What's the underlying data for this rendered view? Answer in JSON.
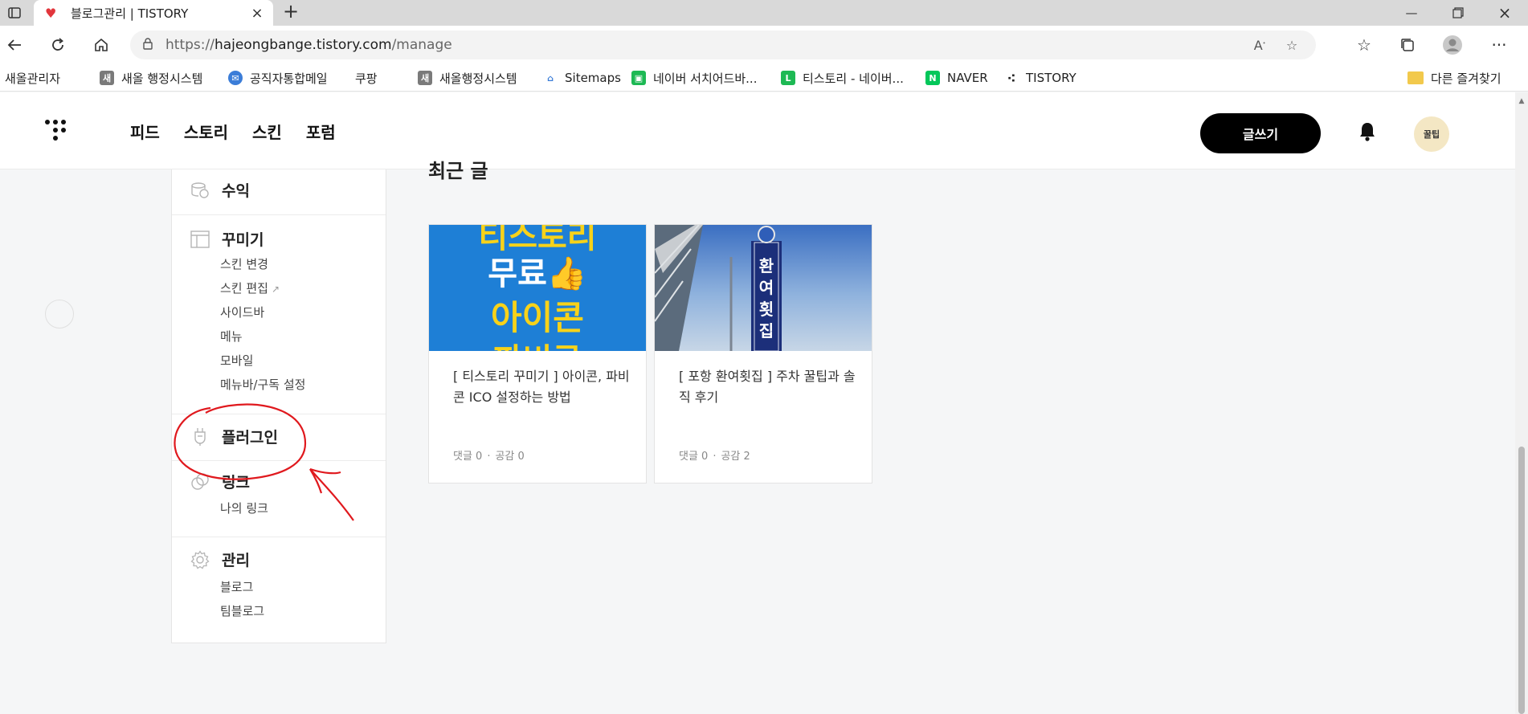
{
  "browser": {
    "tab_title": "블로그관리 | TISTORY",
    "new_tab": "+",
    "url_scheme": "https://",
    "url_host": "hajeongbange.tistory.com",
    "url_path": "/manage"
  },
  "bookmarks": [
    {
      "label": "새올관리자",
      "icon": "page-icon"
    },
    {
      "label": "새올 행정시스템",
      "icon": "saeol-icon"
    },
    {
      "label": "공직자통합메일",
      "icon": "mail-icon"
    },
    {
      "label": "쿠팡",
      "icon": "page-icon"
    },
    {
      "label": "새올행정시스템",
      "icon": "saeol-icon"
    },
    {
      "label": "Sitemaps",
      "icon": "sitemaps-icon"
    },
    {
      "label": "네이버 서치어드바...",
      "icon": "naver-searchadvisor-icon"
    },
    {
      "label": "티스토리 - 네이버...",
      "icon": "line-icon"
    },
    {
      "label": "NAVER",
      "icon": "naver-icon"
    },
    {
      "label": "TISTORY",
      "icon": "tistory-icon"
    }
  ],
  "other_favorites": "다른 즐겨찾기",
  "header": {
    "nav": [
      "피드",
      "스토리",
      "스킨",
      "포럼"
    ],
    "write_button": "글쓰기",
    "avatar_text": "꿀팁"
  },
  "sidebar": {
    "revenue": {
      "title": "수익"
    },
    "decorate": {
      "title": "꾸미기",
      "items": [
        "스킨 변경",
        "스킨 편집",
        "사이드바",
        "메뉴",
        "모바일",
        "메뉴바/구독 설정"
      ],
      "external_mark": "↗"
    },
    "plugin": {
      "title": "플러그인"
    },
    "link": {
      "title": "링크",
      "items": [
        "나의 링크"
      ]
    },
    "manage": {
      "title": "관리",
      "items": [
        "블로그",
        "팀블로그"
      ]
    }
  },
  "main": {
    "section_title": "최근 글",
    "posts": [
      {
        "title": "[ 티스토리 꾸미기 ] 아이콘, 파비콘 ICO 설정하는 방법",
        "comments": "댓글 0",
        "likes": "공감 0",
        "thumb_lines": [
          "티스토리",
          "무료👍",
          "아이콘",
          "파비콘"
        ]
      },
      {
        "title": "[ 포항 환여횟집 ] 주차 꿀팁과 솔직 후기",
        "comments": "댓글 0",
        "likes": "공감 2",
        "thumb_sign": "환여횟집"
      }
    ]
  },
  "colors": {
    "accent_black": "#000000",
    "annotation_red": "#e0191e",
    "page_bg": "#f5f6f7"
  }
}
